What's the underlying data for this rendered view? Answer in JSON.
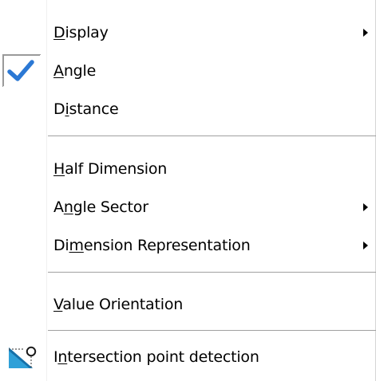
{
  "menu": {
    "items": [
      {
        "id": "display",
        "pre": "",
        "ul": "D",
        "post": "isplay",
        "submenu": true,
        "checked": false
      },
      {
        "id": "angle",
        "pre": "",
        "ul": "A",
        "post": "ngle",
        "submenu": false,
        "checked": true
      },
      {
        "id": "distance",
        "pre": "D",
        "ul": "i",
        "post": "stance",
        "submenu": false,
        "checked": false
      },
      {
        "id": "half-dimension",
        "pre": "",
        "ul": "H",
        "post": "alf Dimension",
        "submenu": false,
        "checked": false
      },
      {
        "id": "angle-sector",
        "pre": "A",
        "ul": "n",
        "post": "gle Sector",
        "submenu": true,
        "checked": false
      },
      {
        "id": "dimension-representation",
        "pre": "Di",
        "ul": "m",
        "post": "ension Representation",
        "submenu": true,
        "checked": false
      },
      {
        "id": "value-orientation",
        "pre": "",
        "ul": "V",
        "post": "alue Orientation",
        "submenu": false,
        "checked": false
      },
      {
        "id": "intersection-point-detection",
        "pre": "I",
        "ul": "n",
        "post": "tersection point detection",
        "submenu": false,
        "checked": false,
        "icon": "intersection-point-icon"
      }
    ]
  },
  "colors": {
    "check": "#2b78d4",
    "separator": "#a0a0a0",
    "text": "#000000"
  }
}
